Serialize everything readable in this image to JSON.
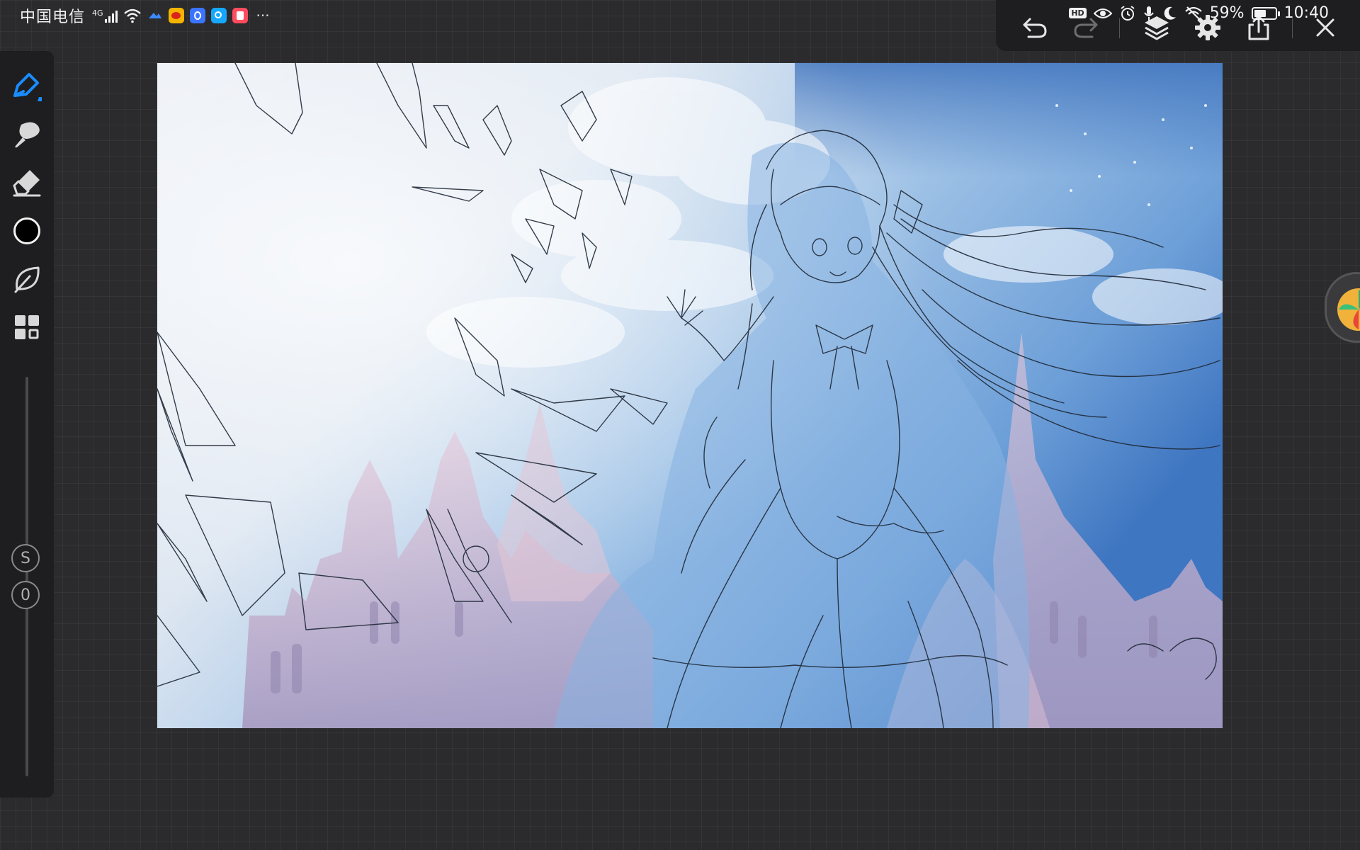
{
  "status_bar": {
    "carrier": "中国电信",
    "network": "4G",
    "more": "···",
    "battery_percent": "59%",
    "battery_level": 0.59,
    "time": "10:40",
    "hd": "HD"
  },
  "toolbar_icons": {
    "undo": "undo-icon",
    "redo": "redo-icon",
    "layers": "layers-icon",
    "settings": "gear-icon",
    "export": "share-export-icon",
    "close": "close-icon"
  },
  "left_tools": {
    "pen": "pen-icon",
    "smudge": "smudge-brush-icon",
    "eraser": "eraser-icon",
    "color": "#000000",
    "blend": "leaf-icon",
    "more": "grid-icon"
  },
  "brush": {
    "size_label": "S",
    "opacity_label": "0"
  },
  "colors": {
    "background": "#2b2b2d",
    "panel": "#1e1e20",
    "accent": "#1a8cff"
  }
}
